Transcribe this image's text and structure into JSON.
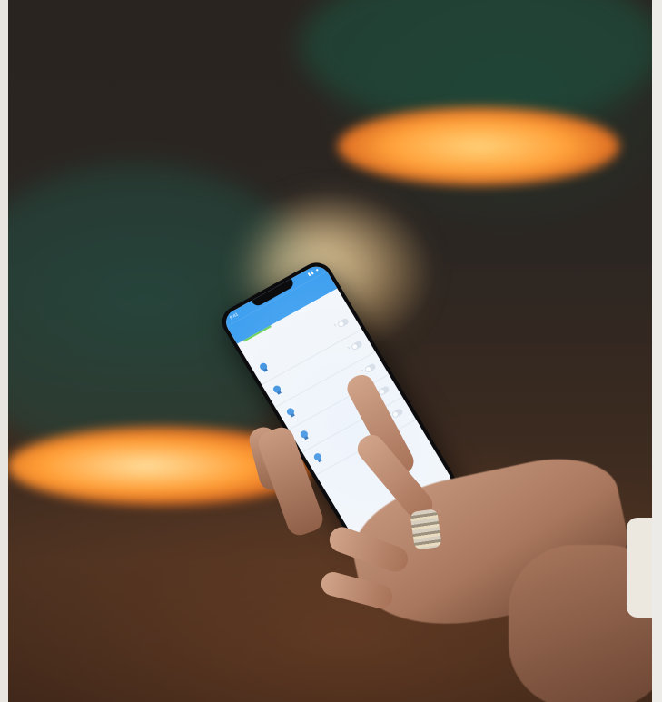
{
  "phone_screen": {
    "status_time": "9:41",
    "status_icons": "▮▮ ●",
    "header_title": "",
    "section_labels": [
      "",
      ""
    ],
    "rows": [
      {
        "name": "",
        "sub": ""
      },
      {
        "name": "",
        "sub": ""
      },
      {
        "name": "",
        "sub": ""
      },
      {
        "name": "",
        "sub": ""
      },
      {
        "name": "",
        "sub": ""
      }
    ],
    "accent_color": "#3fa0f0",
    "indicator_color": "#6cd05a",
    "bulb_icon": "lightbulb-icon"
  }
}
